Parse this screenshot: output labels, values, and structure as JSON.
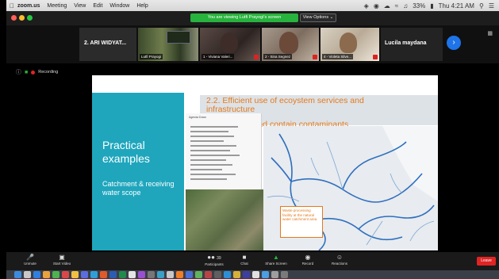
{
  "menubar": {
    "app_name": "zoom.us",
    "items": [
      "Meeting",
      "View",
      "Edit",
      "Window",
      "Help"
    ],
    "clock": "Thu 4:21 AM",
    "battery": "33%"
  },
  "window": {
    "viewing_banner": "You are viewing Lutfi Prayogi's screen",
    "view_options_label": "View Options ⌄"
  },
  "gallery": {
    "participants": [
      {
        "name": "2. ARI WIDYAT..."
      },
      {
        "caption": "Lutfi Prayogi"
      },
      {
        "caption": "1 - Viviana Valeri..."
      },
      {
        "caption": "2 - Sina Segnez"
      },
      {
        "caption": "4 - Violeta Silve..."
      },
      {
        "name": "Lucila maydana"
      }
    ],
    "next_arrow": "›"
  },
  "meeting": {
    "recording_label": "Recording"
  },
  "slide": {
    "heading_1": "2.2. Efficient use of ecoystem services and infrastructure",
    "heading_2": "3.3. Reduce and contain contaminants",
    "left_title": "Practical examples",
    "left_subtitle": "Catchment & receiving water scope",
    "legend_title": "Agenda Down",
    "map_note": "Waste processing facility at the natural water catchment area"
  },
  "controls": {
    "unmute": "Unmute",
    "start_video": "Start Video",
    "participants": "Participants",
    "participants_count": "39",
    "chat": "Chat",
    "share_screen": "Share Screen",
    "record": "Record",
    "reactions": "Reactions",
    "leave": "Leave"
  },
  "colors": {
    "zoom_green": "#27b33d",
    "zoom_blue": "#1e74e8",
    "leave_red": "#e02424",
    "slide_teal": "#1fa6bd",
    "slide_orange": "#e47a1b"
  }
}
